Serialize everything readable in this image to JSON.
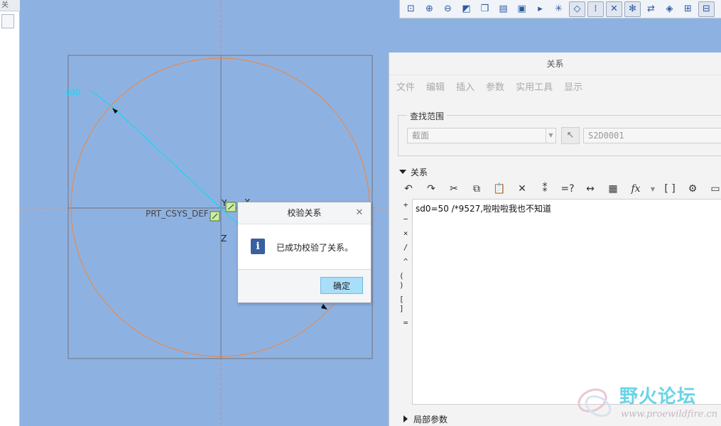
{
  "left_strip": {
    "tab_text": "关"
  },
  "toolbar": {
    "buttons": [
      {
        "name": "refit-icon",
        "glyph": "⊡"
      },
      {
        "name": "zoom-in-icon",
        "glyph": "⊕"
      },
      {
        "name": "zoom-out-icon",
        "glyph": "⊖"
      },
      {
        "name": "repaint-icon",
        "glyph": "◩"
      },
      {
        "name": "saved-orientation-icon",
        "glyph": "❒"
      },
      {
        "name": "named-views-icon",
        "glyph": "▤"
      },
      {
        "name": "display-style-icon",
        "glyph": "▣"
      },
      {
        "name": "perspective-icon",
        "glyph": "▸"
      },
      {
        "name": "datum-display-icon",
        "glyph": "✳"
      },
      {
        "name": "sketch-display-dim-icon",
        "glyph": "◇"
      },
      {
        "name": "sketch-display-constraint-icon",
        "glyph": "⁞"
      },
      {
        "name": "sketch-display-grid-icon",
        "glyph": "✕"
      },
      {
        "name": "sketch-display-vertex-icon",
        "glyph": "✻"
      },
      {
        "name": "sketch-display-lock-icon",
        "glyph": "⇄"
      },
      {
        "name": "sketch-setup-icon",
        "glyph": "◈"
      },
      {
        "name": "sketch-view-icon",
        "glyph": "⊞"
      },
      {
        "name": "sketch-overlap-icon",
        "glyph": "⊟"
      }
    ]
  },
  "sketch": {
    "dimension_label": "sd0",
    "csys_label": "PRT_CSYS_DEF",
    "axis_y": "Y",
    "axis_x": "X",
    "axis_z": "Z"
  },
  "relations": {
    "title": "关系",
    "menu": [
      "文件",
      "编辑",
      "插入",
      "参数",
      "实用工具",
      "显示"
    ],
    "scope_label": "查找范围",
    "scope_value": "截面",
    "scope_id": "S2D0001",
    "section_label": "关系",
    "operators": [
      "+",
      "−",
      "×",
      "/",
      "^",
      "( )",
      "[ ]",
      "="
    ],
    "editor_text": "sd0=50 /*9527,啦啦啦我也不知道",
    "local_params_label": "局部参数"
  },
  "dialog": {
    "title": "校验关系",
    "message": "已成功校验了关系。",
    "ok_label": "确定"
  },
  "watermark": {
    "title": "野火论坛",
    "url": "www.proewildfire.cn"
  },
  "colors": {
    "canvas_bg": "#8db2e2",
    "sketch_circle": "#e88a4c",
    "dimension": "#20d4f0",
    "ok_button": "#a9def9"
  }
}
